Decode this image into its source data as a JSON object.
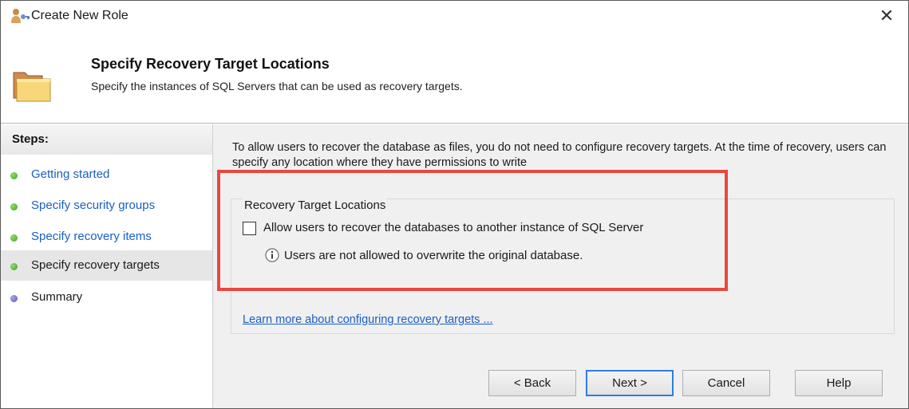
{
  "window": {
    "title": "Create New Role",
    "close_symbol": "✕"
  },
  "header": {
    "title": "Specify Recovery Target Locations",
    "description": "Specify the instances of SQL Servers that can be used as recovery targets."
  },
  "sidebar": {
    "steps_label": "Steps:",
    "items": [
      {
        "label": "Getting started",
        "status": "completed"
      },
      {
        "label": "Specify security groups",
        "status": "completed"
      },
      {
        "label": "Specify recovery items",
        "status": "completed"
      },
      {
        "label": "Specify recovery targets",
        "status": "current"
      },
      {
        "label": "Summary",
        "status": "pending"
      }
    ]
  },
  "main": {
    "intro_text": "To allow users to recover the database as files, you do not need to configure recovery targets. At the time of recovery, users can specify any location where they have permissions to write",
    "group": {
      "title": "Recovery Target Locations",
      "checkbox_label": "Allow users to recover the databases to another instance of SQL Server",
      "checkbox_checked": false,
      "info_text": "Users are not allowed to overwrite the original database."
    },
    "learn_more_link": "Learn more about configuring recovery targets ..."
  },
  "buttons": {
    "back": "< Back",
    "next": "Next >",
    "cancel": "Cancel",
    "help": "Help"
  },
  "colors": {
    "highlight": "#e8473f",
    "link": "#1a5fc4",
    "completed_dot": "#3f9d22",
    "pending_dot": "#5a52c7"
  },
  "icons": {
    "title": "role-users-icon",
    "header": "folder-icon",
    "info": "info-icon"
  }
}
